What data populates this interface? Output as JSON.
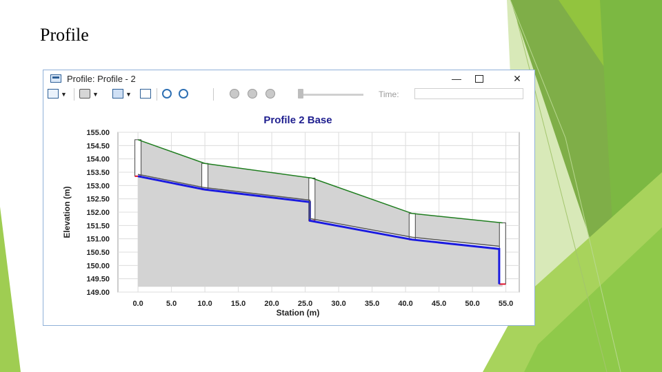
{
  "slide": {
    "title": "Profile"
  },
  "window": {
    "title": "Profile:  Profile - 2",
    "minimize": "—",
    "close": "✕"
  },
  "toolbar": {
    "time_label": "Time:",
    "time_value": "",
    "icons": [
      "layers-icon",
      "print-icon",
      "copy-icon",
      "zoom-in-icon",
      "zoom-out-icon",
      "rewind-icon",
      "pause-icon",
      "play-icon"
    ]
  },
  "chart_data": {
    "type": "line",
    "title": "Profile   2   Base",
    "xlabel": "Station (m)",
    "ylabel": "Elevation (m)",
    "xlim": [
      -3,
      57
    ],
    "ylim": [
      149.0,
      155.0
    ],
    "x_ticks": [
      "0.0",
      "5.0",
      "10.0",
      "15.0",
      "20.0",
      "25.0",
      "30.0",
      "35.0",
      "40.0",
      "45.0",
      "50.0",
      "55.0"
    ],
    "y_ticks": [
      "149.00",
      "149.50",
      "150.00",
      "150.50",
      "151.00",
      "151.50",
      "152.00",
      "152.50",
      "153.00",
      "153.50",
      "154.00",
      "154.50",
      "155.00"
    ],
    "grid": true,
    "series": [
      {
        "role": "ground",
        "color": "#1e7d1e",
        "points": [
          [
            0,
            154.72
          ],
          [
            10,
            153.83
          ],
          [
            26,
            153.28
          ],
          [
            41,
            151.95
          ],
          [
            54.5,
            151.6
          ]
        ]
      },
      {
        "role": "invert",
        "color": "#1a1adf",
        "points": [
          [
            0,
            153.35
          ],
          [
            10,
            152.85
          ],
          [
            25.7,
            152.38
          ],
          [
            25.7,
            151.68
          ],
          [
            41,
            150.97
          ],
          [
            54,
            150.62
          ],
          [
            54,
            149.3
          ]
        ]
      },
      {
        "role": "crown",
        "color": "#555555",
        "points": [
          [
            0,
            153.42
          ],
          [
            10,
            152.92
          ],
          [
            25.7,
            152.45
          ],
          [
            25.7,
            151.76
          ],
          [
            41,
            151.06
          ],
          [
            54,
            150.72
          ]
        ]
      }
    ],
    "structures": [
      {
        "station": 0,
        "top": 154.72,
        "bottom": 153.35
      },
      {
        "station": 10,
        "top": 153.83,
        "bottom": 152.85
      },
      {
        "station": 26,
        "top": 153.28,
        "bottom": 151.68
      },
      {
        "station": 41,
        "top": 151.95,
        "bottom": 150.97
      },
      {
        "station": 54.5,
        "top": 151.6,
        "bottom": 149.3
      }
    ]
  }
}
